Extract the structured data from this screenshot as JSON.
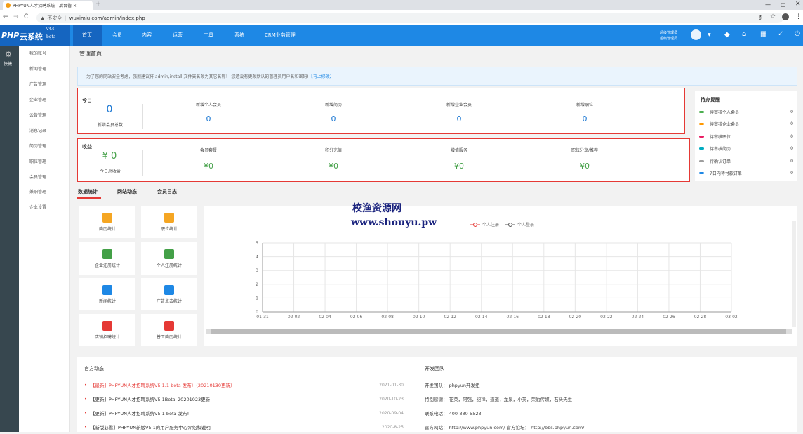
{
  "browser": {
    "tab_title": "PHPYUN人才招聘系统 - 后台管 ×",
    "new_tab": "+",
    "insecure": "不安全",
    "url": "wuximiu.com/admin/index.php"
  },
  "brand": {
    "logo": "PHP",
    "name": "云系统",
    "version": "V4.6",
    "edition": "beta"
  },
  "nav": [
    "首页",
    "会员",
    "内容",
    "运营",
    "工具",
    "系统",
    "CRM业务管理"
  ],
  "admin": {
    "line1": "超级管理员",
    "line2": "超级管理员"
  },
  "leftbar": {
    "label": "快捷"
  },
  "sidemenu": [
    "我的账号",
    "新闻管理",
    "广告管理",
    "企业管理",
    "公告管理",
    "消息记录",
    "简历管理",
    "职位管理",
    "会员管理",
    "兼职管理",
    "企业设置"
  ],
  "page_title": "管理首页",
  "alert": {
    "text": "为了您的网站安全考虑，强烈建议将 admin,install 文件夹名改为其它名称！  您还没有更改默认的管理员用户名和密码!",
    "link": "【马上修改】"
  },
  "today": {
    "title": "今日",
    "total_value": "0",
    "total_label": "新增会员总数",
    "items": [
      {
        "label": "新增个人会员",
        "value": "0"
      },
      {
        "label": "新增简历",
        "value": "0"
      },
      {
        "label": "新增企业会员",
        "value": "0"
      },
      {
        "label": "新增职位",
        "value": "0"
      }
    ]
  },
  "income": {
    "title": "收益",
    "total_value": "¥ 0",
    "total_label": "今日总收益",
    "items": [
      {
        "label": "会员套餐",
        "value": "¥0"
      },
      {
        "label": "积分充值",
        "value": "¥0"
      },
      {
        "label": "增值服务",
        "value": "¥0"
      },
      {
        "label": "职位分享/推荐",
        "value": "¥0"
      }
    ]
  },
  "todo": {
    "title": "待办提醒",
    "items": [
      {
        "label": "待审核个人会员",
        "count": "0",
        "color": "#4caf50"
      },
      {
        "label": "待审核企业会员",
        "count": "0",
        "color": "#ff9800"
      },
      {
        "label": "待审核职位",
        "count": "0",
        "color": "#e91e63"
      },
      {
        "label": "待审核简历",
        "count": "0",
        "color": "#00acc1"
      },
      {
        "label": "待确认订单",
        "count": "0",
        "color": "#9e9e9e"
      },
      {
        "label": "7日内待付款订单",
        "count": "0",
        "color": "#1e88e5"
      }
    ]
  },
  "tabs": [
    "数据统计",
    "网站动态",
    "会员日志"
  ],
  "tiles": [
    {
      "label": "简历统计",
      "color": "#f5a623"
    },
    {
      "label": "职位统计",
      "color": "#f5a623"
    },
    {
      "label": "企业注册统计",
      "color": "#43a047"
    },
    {
      "label": "个人注册统计",
      "color": "#43a047"
    },
    {
      "label": "新闻统计",
      "color": "#1e88e5"
    },
    {
      "label": "广告点击统计",
      "color": "#1e88e5"
    },
    {
      "label": "店铺招聘统计",
      "color": "#e53935"
    },
    {
      "label": "普工简历统计",
      "color": "#e53935"
    }
  ],
  "watermark": {
    "line1": "校渔资源网",
    "line2": "www.shouyu.pw"
  },
  "chart_data": {
    "type": "line",
    "categories": [
      "01-31",
      "02-02",
      "02-04",
      "02-06",
      "02-08",
      "02-10",
      "02-12",
      "02-14",
      "02-16",
      "02-18",
      "02-20",
      "02-22",
      "02-24",
      "02-26",
      "02-28",
      "03-02"
    ],
    "series": [
      {
        "name": "个人注册",
        "color": "#e53935"
      },
      {
        "name": "个人登录",
        "color": "#555555"
      }
    ],
    "yticks": [
      "0",
      "1",
      "2",
      "3",
      "4",
      "5"
    ],
    "ylim": [
      0,
      5
    ]
  },
  "official": {
    "title": "官方动态",
    "items": [
      {
        "text": "【最新】PHPYUN人才招聘系统V5.1.1 beta 发布!（20210130更新）",
        "date": "2021-01-30",
        "color": "#e53935"
      },
      {
        "text": "【更新】PHPYUN人才招聘系统V5.1Beta_20201023更新",
        "date": "2020-10-23",
        "color": "#333333"
      },
      {
        "text": "【更新】PHPYUN人才招聘系统V5.1 beta 发布!",
        "date": "2020-09-04",
        "color": "#333333"
      },
      {
        "text": "【新版必看】PHPYUN新版V5.1的用户服务中心介绍和说明",
        "date": "2020-8-25",
        "color": "#333333"
      }
    ]
  },
  "team": {
    "title": "开发团队",
    "rows": [
      "开发团队：  phpyun开发组",
      "特别感谢：  花菜，阿强，纪祥，道道，龙泉，小芙，荣豹传媒，石头先生",
      "联系电话：  400-880-5523",
      "官方网站：  http://www.phpyun.com/  官方论坛：  http://bbs.phpyun.com/"
    ]
  }
}
